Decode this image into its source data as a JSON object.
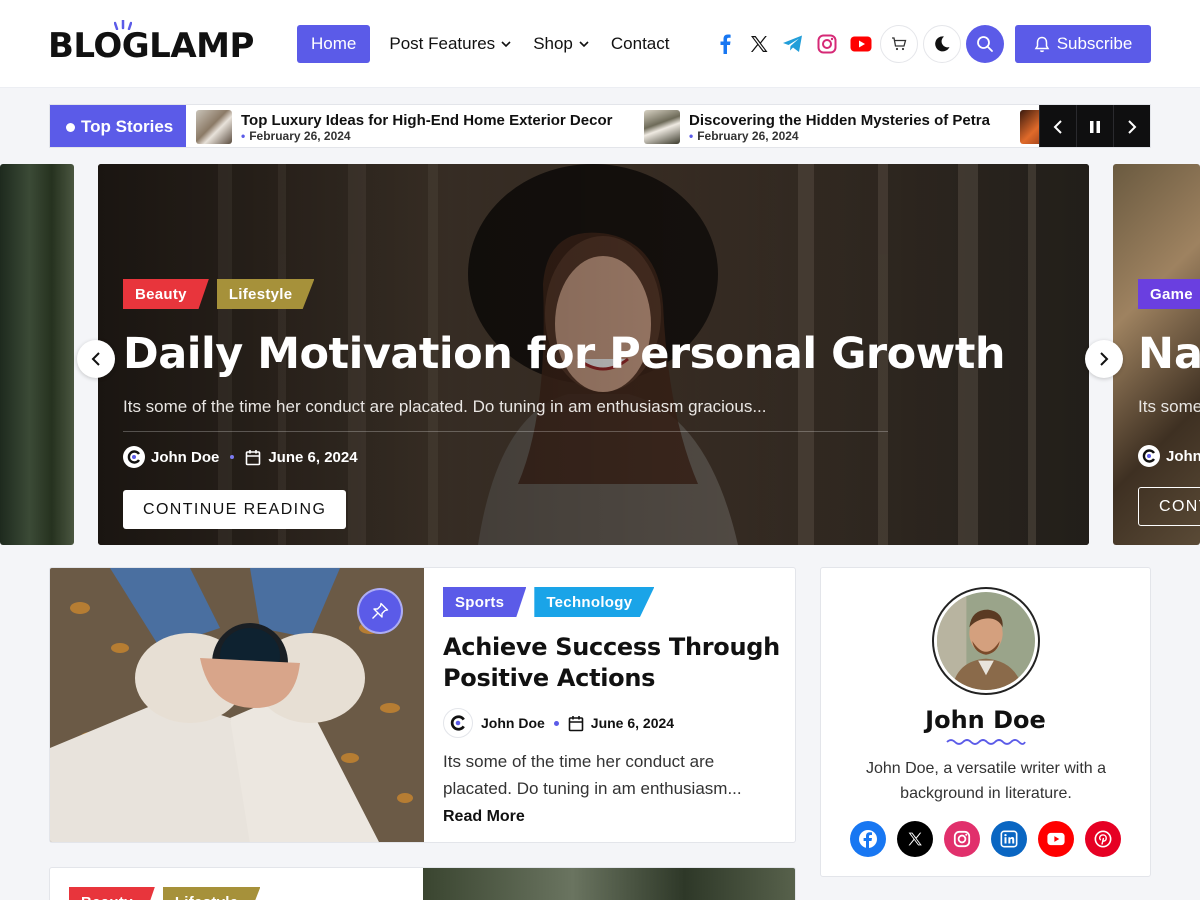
{
  "header": {
    "logo": "BLOGLAMP",
    "nav": [
      {
        "label": "Home",
        "active": true,
        "has_dropdown": false
      },
      {
        "label": "Post Features",
        "active": false,
        "has_dropdown": true
      },
      {
        "label": "Shop",
        "active": false,
        "has_dropdown": true
      },
      {
        "label": "Contact",
        "active": false,
        "has_dropdown": false
      }
    ],
    "socials": [
      "facebook-icon",
      "x-icon",
      "telegram-icon",
      "instagram-icon",
      "youtube-icon"
    ],
    "subscribe_label": "Subscribe"
  },
  "ticker": {
    "label": "Top Stories",
    "items": [
      {
        "title": "Top Luxury Ideas for High-End Home Exterior Decor",
        "date": "February 26, 2024"
      },
      {
        "title": "Discovering the Hidden Mysteries of Petra",
        "date": "February 26, 2024"
      }
    ]
  },
  "hero": {
    "tags": [
      {
        "label": "Beauty",
        "color": "#e8353c"
      },
      {
        "label": "Lifestyle",
        "color": "#a6913a"
      }
    ],
    "title": "Daily Motivation for Personal Growth",
    "excerpt": "Its some of the time her conduct are placated. Do tuning in am enthusiasm gracious...",
    "author": "John Doe",
    "date": "June 6, 2024",
    "cta": "CONTINUE READING"
  },
  "hero_next": {
    "tag": {
      "label": "Game",
      "color": "#6a3fe0"
    },
    "title": "Nav",
    "excerpt": "Its some",
    "author": "John",
    "cta": "CONT"
  },
  "post": {
    "tags": [
      {
        "label": "Sports",
        "color": "#5b5be8"
      },
      {
        "label": "Technology",
        "color": "#1aa4e8"
      }
    ],
    "title": "Achieve Success Through Positive Actions",
    "author": "John Doe",
    "date": "June 6, 2024",
    "excerpt": "Its some of the time her conduct are placated. Do tuning in am enthusiasm...",
    "read_more": "Read More"
  },
  "author_widget": {
    "name": "John Doe",
    "bio": "John Doe, a versatile writer with a background in literature.",
    "socials": [
      {
        "icon": "facebook-icon",
        "color": "#1877f2"
      },
      {
        "icon": "x-icon",
        "color": "#000000"
      },
      {
        "icon": "instagram-icon",
        "color": "#e1306c"
      },
      {
        "icon": "linkedin-icon",
        "color": "#0a66c2"
      },
      {
        "icon": "youtube-icon",
        "color": "#ff0000"
      },
      {
        "icon": "pinterest-icon",
        "color": "#e60023"
      }
    ]
  },
  "card2": {
    "tags": [
      {
        "label": "Beauty",
        "color": "#e8353c"
      },
      {
        "label": "Lifestyle",
        "color": "#a6913a"
      }
    ]
  },
  "colors": {
    "accent": "#5b5be8"
  }
}
